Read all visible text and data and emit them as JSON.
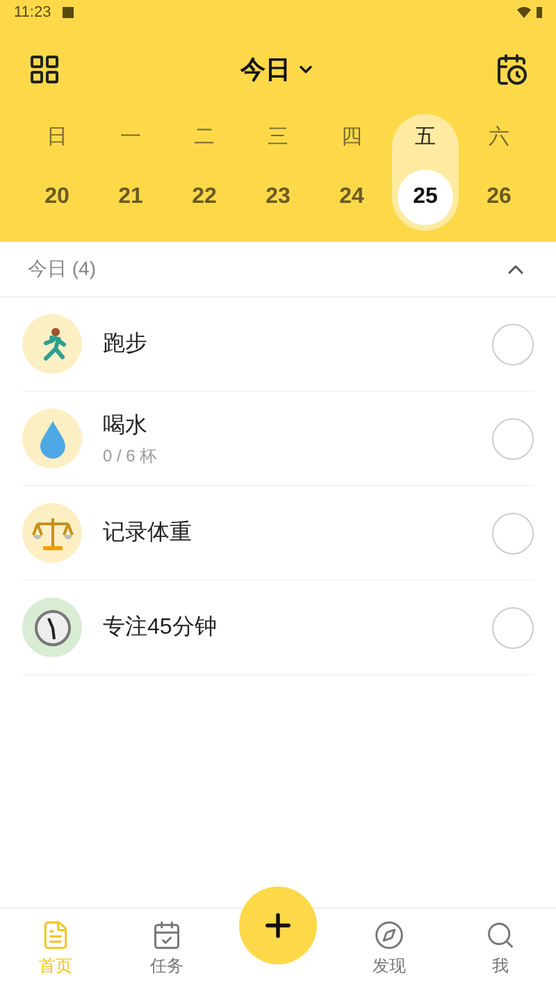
{
  "status_bar": {
    "time": "11:23"
  },
  "header": {
    "title": "今日"
  },
  "week": [
    {
      "weekday": "日",
      "date": "20",
      "selected": false
    },
    {
      "weekday": "一",
      "date": "21",
      "selected": false
    },
    {
      "weekday": "二",
      "date": "22",
      "selected": false
    },
    {
      "weekday": "三",
      "date": "23",
      "selected": false
    },
    {
      "weekday": "四",
      "date": "24",
      "selected": false
    },
    {
      "weekday": "五",
      "date": "25",
      "selected": true
    },
    {
      "weekday": "六",
      "date": "26",
      "selected": false
    }
  ],
  "section": {
    "title": "今日 (4)",
    "expanded": true
  },
  "habits": [
    {
      "name": "跑步",
      "color": "#fdefc4",
      "checked": false
    },
    {
      "name": "喝水",
      "detail": "0 / 6 杯",
      "color": "#fdefc4",
      "checked": false
    },
    {
      "name": "记录体重",
      "color": "#fdefc4",
      "checked": false
    },
    {
      "name": "专注45分钟",
      "color": "#d9ecd4",
      "checked": false
    }
  ],
  "nav": [
    {
      "label": "首页",
      "selected": true
    },
    {
      "label": "任务",
      "selected": false
    },
    {
      "label": "发现",
      "selected": false
    },
    {
      "label": "我",
      "selected": false
    }
  ]
}
